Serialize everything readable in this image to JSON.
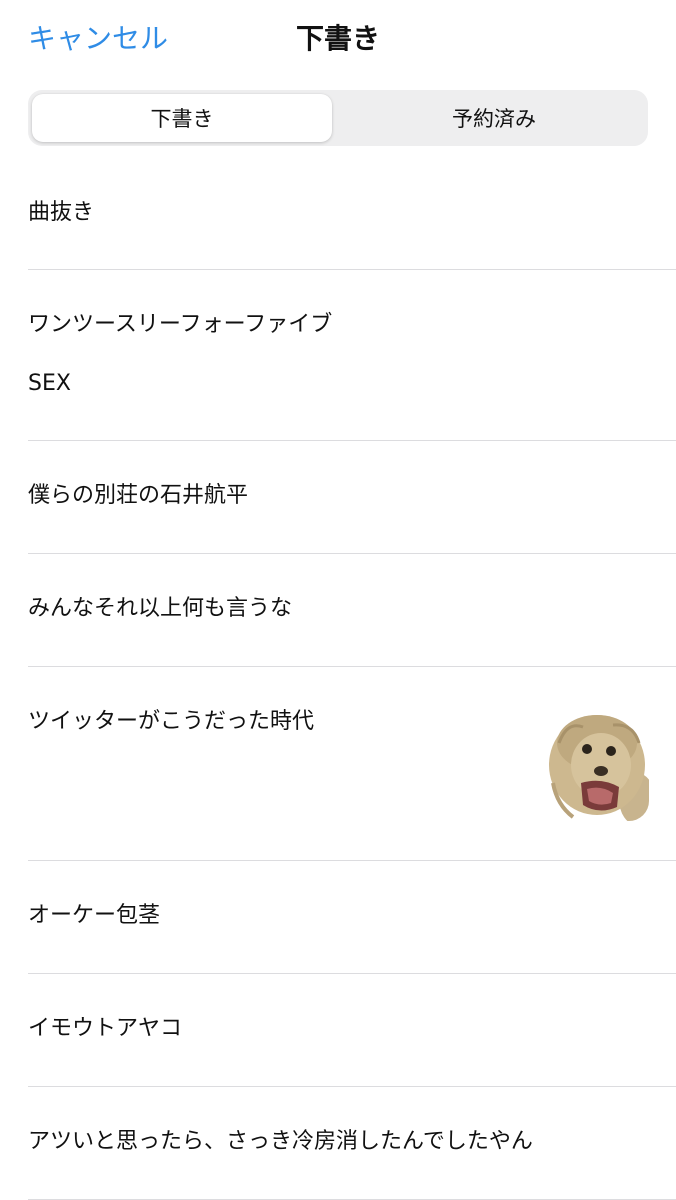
{
  "header": {
    "cancel_label": "キャンセル",
    "title": "下書き"
  },
  "segments": [
    {
      "label": "下書き",
      "selected": true
    },
    {
      "label": "予約済み",
      "selected": false
    }
  ],
  "drafts": [
    {
      "lines": [
        "曲抜き"
      ]
    },
    {
      "lines": [
        "ワンツースリーフォーファイブ",
        "SEX"
      ]
    },
    {
      "lines": [
        "僕らの別荘の石井航平"
      ]
    },
    {
      "lines": [
        "みんなそれ以上何も言うな"
      ]
    },
    {
      "lines": [
        "ツイッターがこうだった時代"
      ],
      "has_image": true,
      "image_icon": "lion-head-photo"
    },
    {
      "lines": [
        "オーケー包茎"
      ]
    },
    {
      "lines": [
        "イモウトアヤコ"
      ]
    },
    {
      "lines": [
        "アツいと思ったら、さっき冷房消したんでしたやん"
      ]
    }
  ],
  "colors": {
    "accent": "#2f8ce6",
    "separator": "#dcdcdf",
    "segment_bg": "#eeeeef"
  }
}
